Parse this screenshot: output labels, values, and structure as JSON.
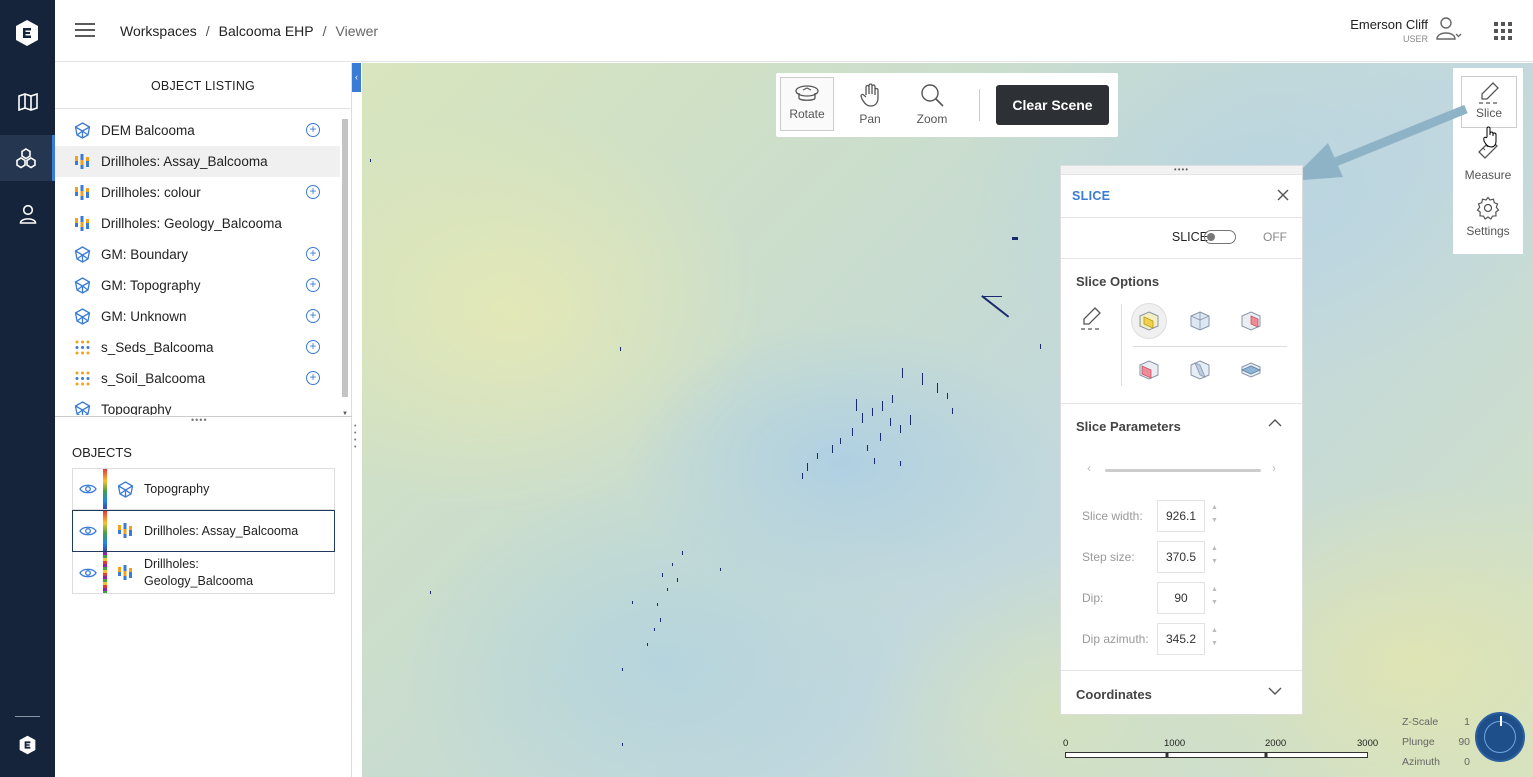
{
  "header": {
    "breadcrumb": [
      "Workspaces",
      "Balcooma EHP",
      "Viewer"
    ],
    "user_name": "Emerson Cliff",
    "user_role": "USER"
  },
  "rail": {
    "icons": [
      "logo-icon",
      "map-icon",
      "objects-icon",
      "user-icon",
      "logo-icon"
    ]
  },
  "listing": {
    "title": "OBJECT LISTING",
    "items": [
      {
        "label": "DEM Balcooma",
        "icon": "mesh",
        "add": true
      },
      {
        "label": "Drillholes: Assay_Balcooma",
        "icon": "drill",
        "add": false
      },
      {
        "label": "Drillholes: colour",
        "icon": "drill",
        "add": true
      },
      {
        "label": "Drillholes: Geology_Balcooma",
        "icon": "drill",
        "add": false
      },
      {
        "label": "GM: Boundary",
        "icon": "mesh",
        "add": true
      },
      {
        "label": "GM: Topography",
        "icon": "mesh",
        "add": true
      },
      {
        "label": "GM: Unknown",
        "icon": "mesh",
        "add": true
      },
      {
        "label": "s_Seds_Balcooma",
        "icon": "points",
        "add": true
      },
      {
        "label": "s_Soil_Balcooma",
        "icon": "points",
        "add": true
      },
      {
        "label": "Topography",
        "icon": "mesh",
        "add": false
      }
    ]
  },
  "objects": {
    "title": "OBJECTS",
    "items": [
      {
        "label": "Topography",
        "icon": "mesh"
      },
      {
        "label": "Drillholes: Assay_Balcooma",
        "icon": "drill"
      },
      {
        "label": "Drillholes:",
        "label2": "Geology_Balcooma",
        "icon": "drill"
      }
    ]
  },
  "toolbar": {
    "rotate": "Rotate",
    "pan": "Pan",
    "zoom": "Zoom",
    "clear": "Clear Scene"
  },
  "right_tools": {
    "slice": "Slice",
    "measure": "Measure",
    "settings": "Settings"
  },
  "slice_panel": {
    "title": "SLICE",
    "toggle_label": "SLICE",
    "toggle_state": "OFF",
    "options_title": "Slice Options",
    "params_title": "Slice Parameters",
    "params": [
      {
        "label": "Slice width:",
        "value": "926.1"
      },
      {
        "label": "Step size:",
        "value": "370.5"
      },
      {
        "label": "Dip:",
        "value": "90"
      },
      {
        "label": "Dip azimuth:",
        "value": "345.2"
      }
    ],
    "coords_title": "Coordinates"
  },
  "view_info": {
    "zscale_label": "Z-Scale",
    "zscale": "1",
    "plunge_label": "Plunge",
    "plunge": "90",
    "azimuth_label": "Azimuth",
    "azimuth": "0"
  },
  "scale_bar": [
    "0",
    "1000",
    "2000",
    "3000"
  ],
  "colors": {
    "rail": "#15243a",
    "accent": "#3a7bd5",
    "clear_button": "#2d3135"
  }
}
